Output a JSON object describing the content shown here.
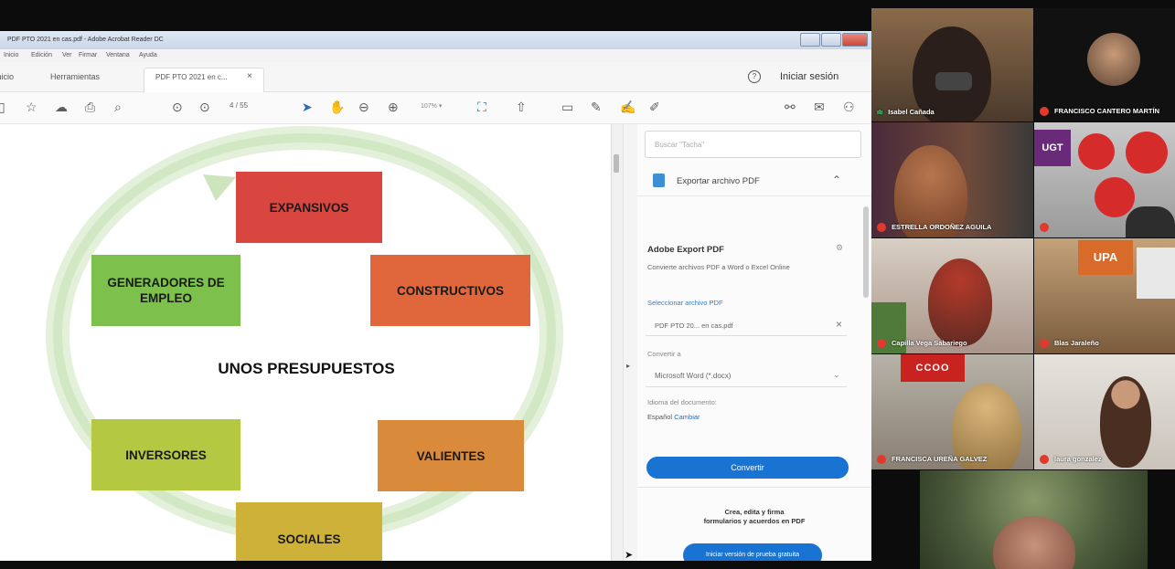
{
  "window": {
    "title": "PDF PTO 2021 en cas.pdf - Adobe Acrobat Reader DC",
    "menu": [
      "Inicio",
      "Edición",
      "Ver",
      "Firmar",
      "Ventana",
      "Ayuda"
    ]
  },
  "tabs": {
    "home": "Inicio",
    "tools": "Herramientas",
    "document": "PDF PTO 2021 en c...",
    "sign_in": "Iniciar sesión"
  },
  "toolbar": {
    "page_current": "4",
    "page_total": "/ 55",
    "zoom": "107%"
  },
  "diagram": {
    "center": "UNOS PRESUPUESTOS",
    "items": [
      "EXPANSIVOS",
      "CONSTRUCTIVOS",
      "VALIENTES",
      "SOCIALES",
      "INVERSORES",
      "GENERADORES DE EMPLEO"
    ],
    "colors": {
      "expansivos": "#d9463f",
      "constructivos": "#e0663b",
      "valientes": "#d98a3a",
      "sociales": "#cdb139",
      "inversores": "#b5c842",
      "generadores": "#7dc04b"
    }
  },
  "panel": {
    "search_placeholder": "Buscar \"Tacha\"",
    "export_header": "Exportar archivo PDF",
    "service_title": "Adobe Export PDF",
    "service_desc": "Convierte archivos PDF a Word o Excel Online",
    "select_label": "Seleccionar archivo PDF",
    "file_name": "PDF PTO 20... en cas.pdf",
    "convert_to_label": "Convertir a",
    "convert_to_value": "Microsoft Word (*.docx)",
    "language_label": "Idioma del documento:",
    "language_value": "Español",
    "language_change": "Cambiar",
    "convert_button": "Convertir",
    "promo_line1": "Crea, edita y firma",
    "promo_line2": "formularios y acuerdos en PDF",
    "trial_button": "Iniciar versión de prueba gratuita"
  },
  "participants": [
    "Isabel Cañada",
    "FRANCISCO CANTERO MARTÍN",
    "ESTRELLA ORDOÑEZ AGUILA",
    "Capilla Vega Sabariego",
    "Blas Jaraleño",
    "FRANCISCA UREÑA GALVEZ",
    "laura gonzalez"
  ],
  "signs": {
    "ugt": "UGT",
    "upa": "UPA",
    "ccoo": "CCOO"
  }
}
